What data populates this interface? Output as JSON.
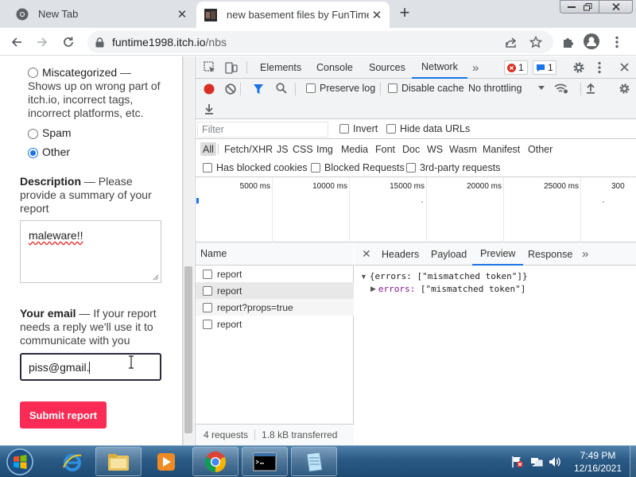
{
  "browser": {
    "tabs": [
      {
        "title": "New Tab",
        "active": false
      },
      {
        "title": "new basement files by FunTime",
        "active": true
      }
    ],
    "address": {
      "host": "funtime1998.itch.io",
      "path": "/nbs"
    }
  },
  "page": {
    "options": [
      {
        "label": "Miscategorized",
        "desc": " — Shows up on wrong part of itch.io, incorrect tags, incorrect platforms, etc.",
        "selected": false
      },
      {
        "label": "Spam",
        "selected": false
      },
      {
        "label": "Other",
        "selected": true
      }
    ],
    "description_label": "Description",
    "description_hint": " — Please provide a summary of your report",
    "description_value": "maleware!!",
    "email_label": "Your email",
    "email_hint": " — If your report needs a reply we'll use it to communicate with you",
    "email_value": "piss@gmail.",
    "submit_label": "Submit report"
  },
  "devtools": {
    "tabs": [
      "Elements",
      "Console",
      "Sources",
      "Network"
    ],
    "active_tab": "Network",
    "error_count": "1",
    "message_count": "1",
    "preserve_log": "Preserve log",
    "disable_cache": "Disable cache",
    "throttling": "No throttling",
    "filter_placeholder": "Filter",
    "invert": "Invert",
    "hide_data_urls": "Hide data URLs",
    "types": [
      "All",
      "Fetch/XHR",
      "JS",
      "CSS",
      "Img",
      "Media",
      "Font",
      "Doc",
      "WS",
      "Wasm",
      "Manifest",
      "Other"
    ],
    "has_blocked_cookies": "Has blocked cookies",
    "blocked_requests": "Blocked Requests",
    "third_party": "3rd-party requests",
    "timeline_ticks": [
      "5000 ms",
      "10000 ms",
      "15000 ms",
      "20000 ms",
      "25000 ms",
      "300"
    ],
    "name_header": "Name",
    "requests": [
      "report",
      "report",
      "report?props=true",
      "report"
    ],
    "status": {
      "requests": "4 requests",
      "transferred": "1.8 kB transferred"
    },
    "detail_tabs": [
      "Headers",
      "Payload",
      "Preview",
      "Response"
    ],
    "active_detail_tab": "Preview",
    "preview_line1": "{errors: [\"mismatched token\"]}",
    "preview_line2_key": "errors: ",
    "preview_line2_val": "[\"mismatched token\"]"
  },
  "taskbar": {
    "time": "7:49 PM",
    "date": "12/16/2021"
  }
}
